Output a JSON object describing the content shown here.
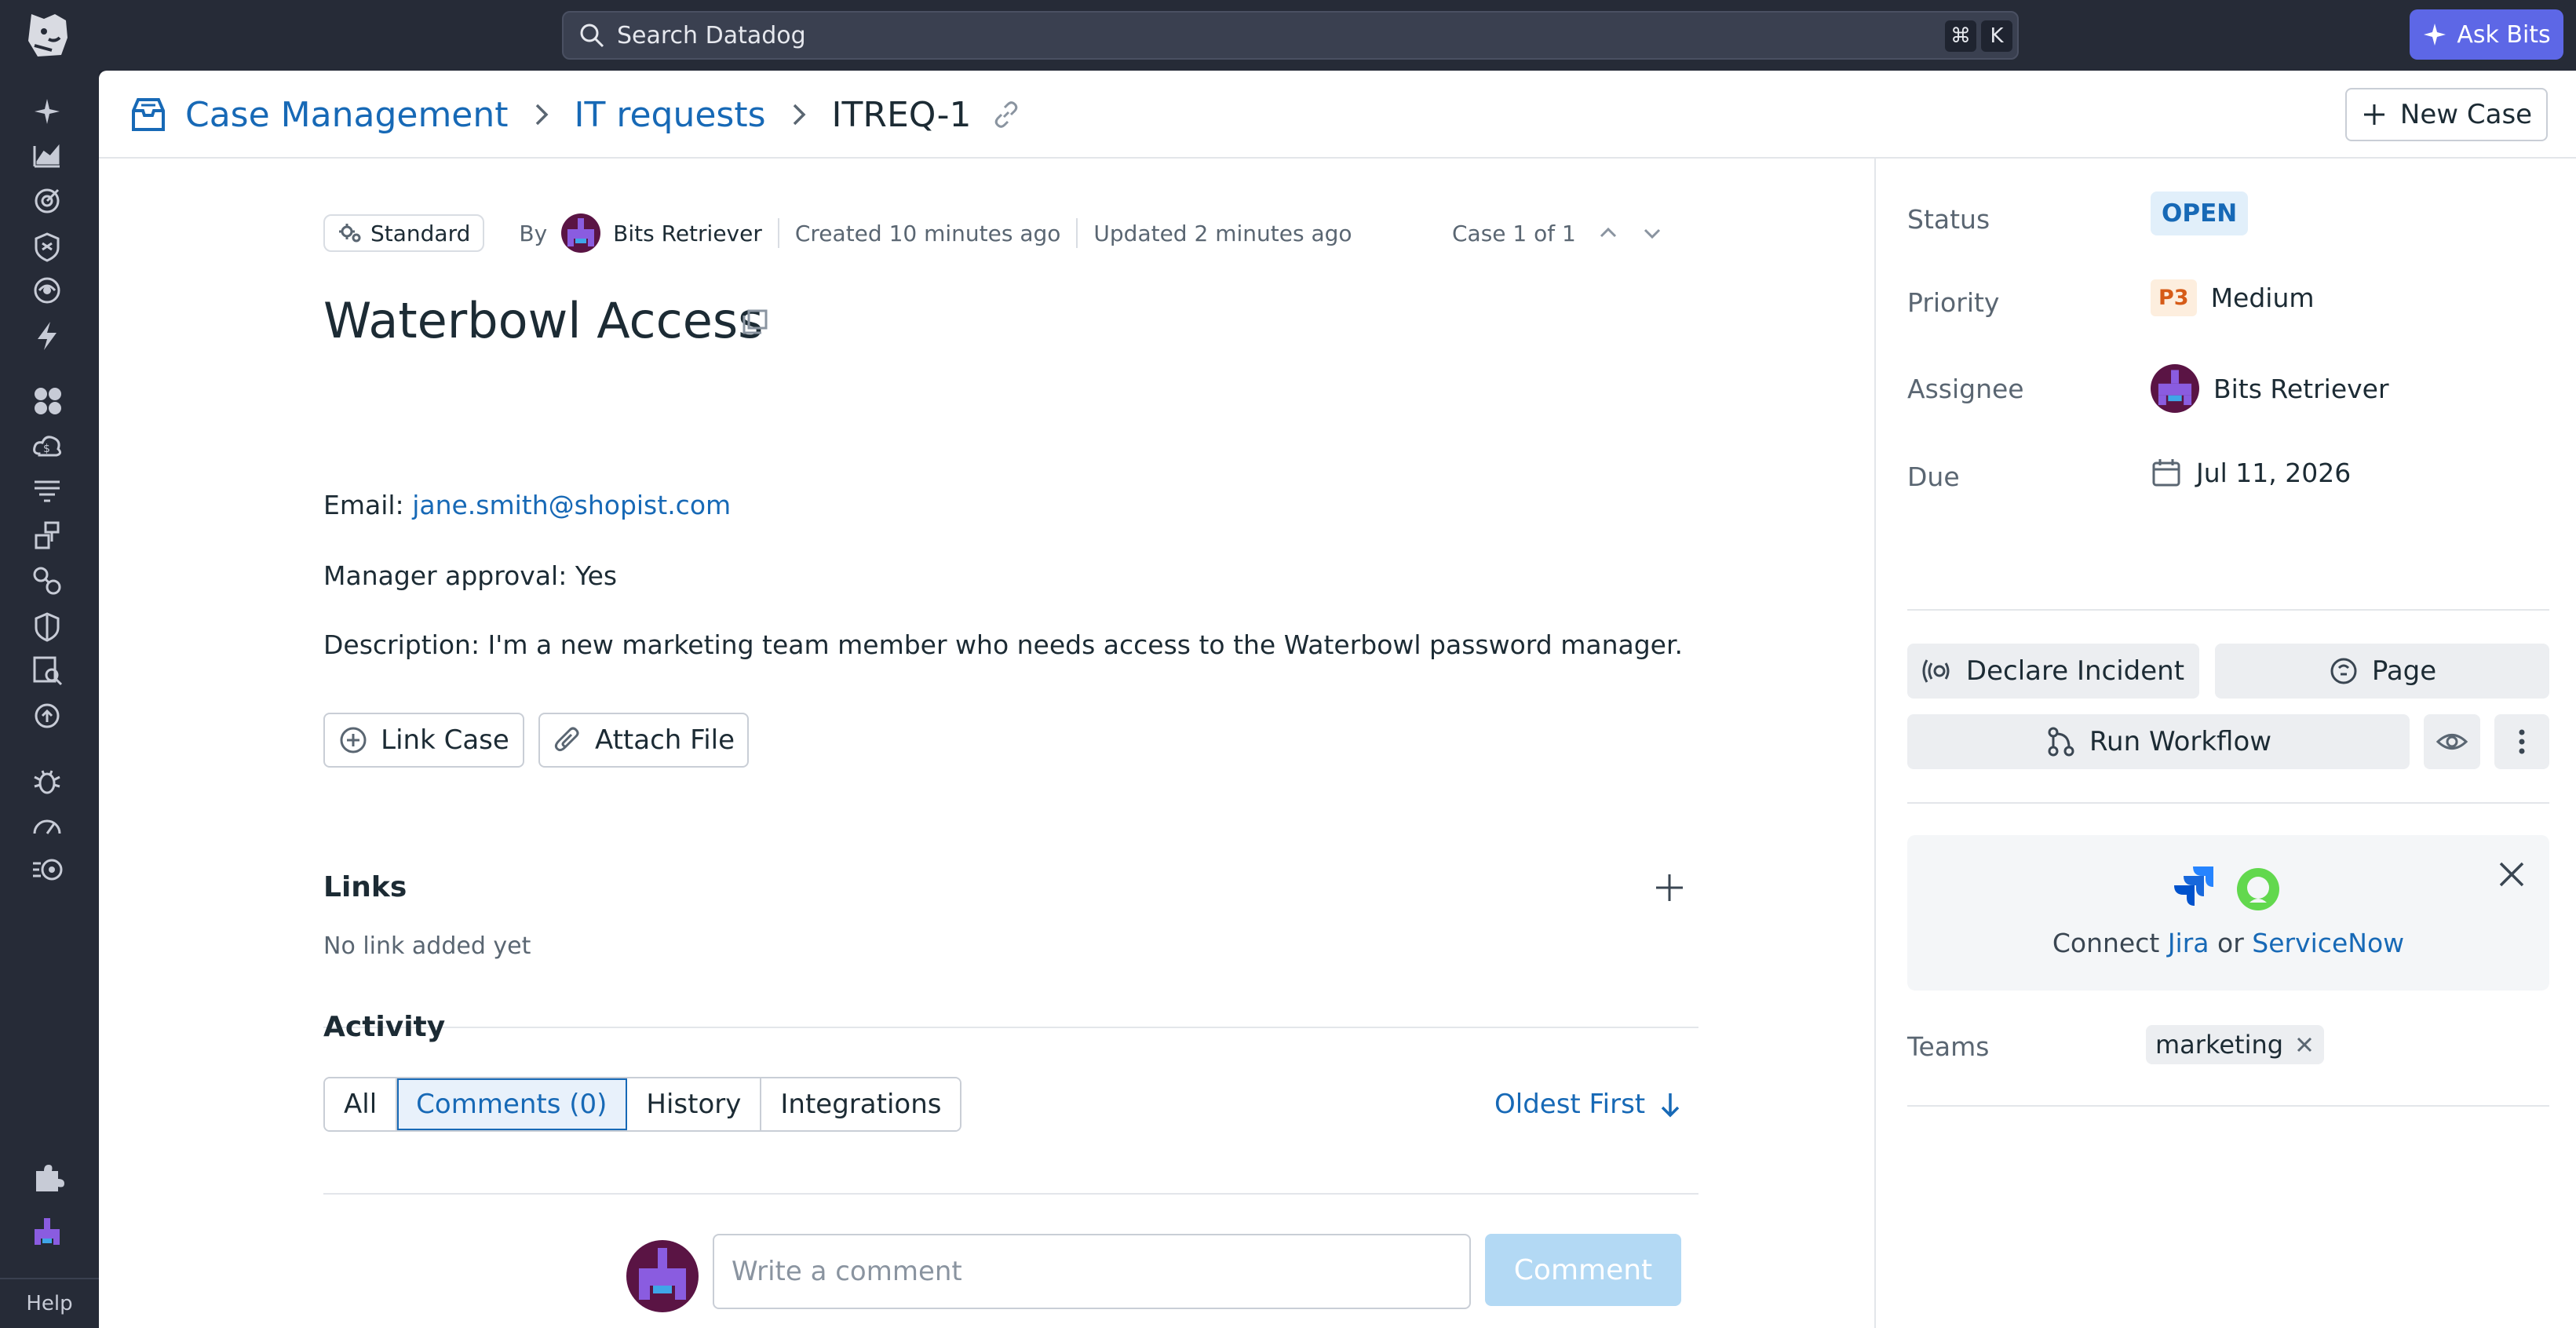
{
  "topbar": {
    "search_placeholder": "Search Datadog",
    "shortcut_mod": "⌘",
    "shortcut_key": "K",
    "ask_bits_label": "Ask Bits"
  },
  "nav": {
    "help_label": "Help"
  },
  "breadcrumb": {
    "root": "Case Management",
    "project": "IT requests",
    "current": "ITREQ-1"
  },
  "header": {
    "new_case_label": "New Case"
  },
  "case": {
    "type": "Standard",
    "by_label": "By",
    "author": "Bits Retriever",
    "created": "Created 10 minutes ago",
    "updated": "Updated 2 minutes ago",
    "position": "Case 1 of 1",
    "title": "Waterbowl Access",
    "email_label": "Email:",
    "email": "jane.smith@shopist.com",
    "approval": "Manager approval: Yes",
    "description": "Description: I'm a new marketing team member who needs access to the Waterbowl password manager."
  },
  "actions": {
    "link_case": "Link Case",
    "attach_file": "Attach File"
  },
  "links": {
    "title": "Links",
    "empty": "No link added yet"
  },
  "activity": {
    "title": "Activity",
    "tabs": [
      "All",
      "Comments (0)",
      "History",
      "Integrations"
    ],
    "active_tab": "Comments (0)",
    "sort_label": "Oldest First",
    "comment_placeholder": "Write a comment",
    "comment_button": "Comment"
  },
  "panel": {
    "status_label": "Status",
    "status_value": "OPEN",
    "priority_label": "Priority",
    "priority_code": "P3",
    "priority_value": "Medium",
    "assignee_label": "Assignee",
    "assignee_value": "Bits Retriever",
    "due_label": "Due",
    "due_value": "Jul 11, 2026",
    "declare_incident": "Declare Incident",
    "page": "Page",
    "run_workflow": "Run Workflow",
    "connect_prefix": "Connect",
    "connect_jira": "Jira",
    "connect_or": "or",
    "connect_servicenow": "ServiceNow",
    "teams_label": "Teams",
    "team_tag": "marketing"
  },
  "colors": {
    "accent": "#1769b6",
    "ask_bits": "#5d67e6",
    "priority_orange": "#d65b17",
    "comment_disabled": "#b3d9f4"
  }
}
